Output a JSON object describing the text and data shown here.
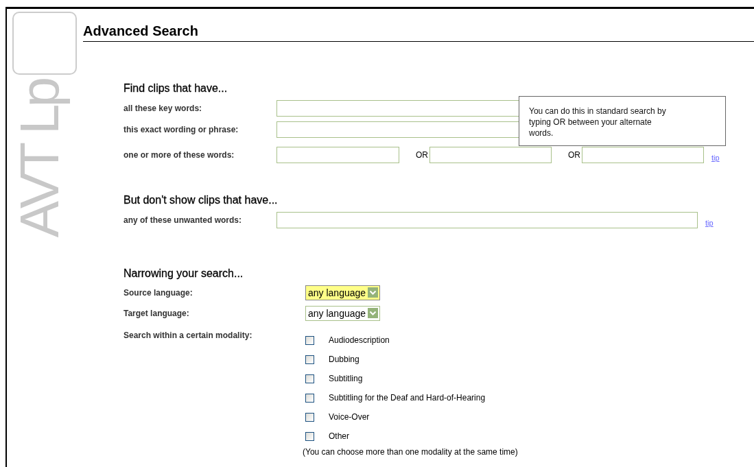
{
  "logo": {
    "text": "AVT Lp"
  },
  "title": "Advanced Search",
  "sections": [
    {
      "heading": "Find clips that have...",
      "rows": [
        {
          "kind": "text",
          "label": "all these key words:"
        },
        {
          "kind": "text",
          "label": "this exact wording or phrase:"
        },
        {
          "kind": "alternatives",
          "label": "one or more of these words:",
          "separators": [
            "OR",
            "OR"
          ],
          "tip": "tip"
        }
      ]
    },
    {
      "heading": "But don't show clips that have...",
      "rows": [
        {
          "kind": "text",
          "label": "any of these unwanted words:",
          "tip": "tip"
        }
      ]
    }
  ],
  "tooltip": {
    "text": "You can do this in standard search by typing OR between your alternate words."
  },
  "narrowing": {
    "heading": "Narrowing your search...",
    "selects": [
      {
        "label": "Source language:",
        "value": "any language",
        "focused": true
      },
      {
        "label": "Target language:",
        "value": "any language",
        "focused": false
      }
    ],
    "modality": {
      "label": "Search within a certain modality:",
      "options": [
        {
          "label": "Audiodescription",
          "checked": false
        },
        {
          "label": "Dubbing",
          "checked": false
        },
        {
          "label": "Subtitling",
          "checked": false
        },
        {
          "label": "Subtitling for the Deaf and Hard-of-Hearing",
          "checked": false
        },
        {
          "label": "Voice-Over",
          "checked": false
        },
        {
          "label": "Other",
          "checked": false
        }
      ],
      "note": "(You can choose more than one modality at the same time)"
    }
  }
}
